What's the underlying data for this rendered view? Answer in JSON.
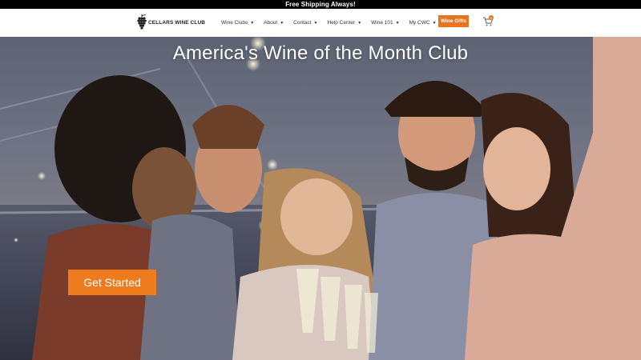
{
  "topbar": {
    "text": "Free Shipping Always!"
  },
  "header": {
    "logo_text": "CELLARS WINE CLUB",
    "nav": [
      {
        "label": "Wine Clubs",
        "icon": "chevron-down-icon"
      },
      {
        "label": "About",
        "icon": "chevron-down-icon"
      },
      {
        "label": "Contact",
        "icon": "chevron-down-icon"
      },
      {
        "label": "Help Center",
        "icon": "chevron-down-icon"
      },
      {
        "label": "Wine 101",
        "icon": "chevron-down-icon"
      },
      {
        "label": "My CWC",
        "icon": "chevron-down-icon"
      }
    ],
    "cta_label": "Wine Gifts",
    "cart_icon": "cart-icon",
    "cart_count": "0"
  },
  "hero": {
    "title": "America's Wine of the Month Club",
    "button_label": "Get Started"
  },
  "colors": {
    "accent": "#e8741f",
    "topbar_bg": "#000000",
    "hero_text": "#ffffff"
  }
}
